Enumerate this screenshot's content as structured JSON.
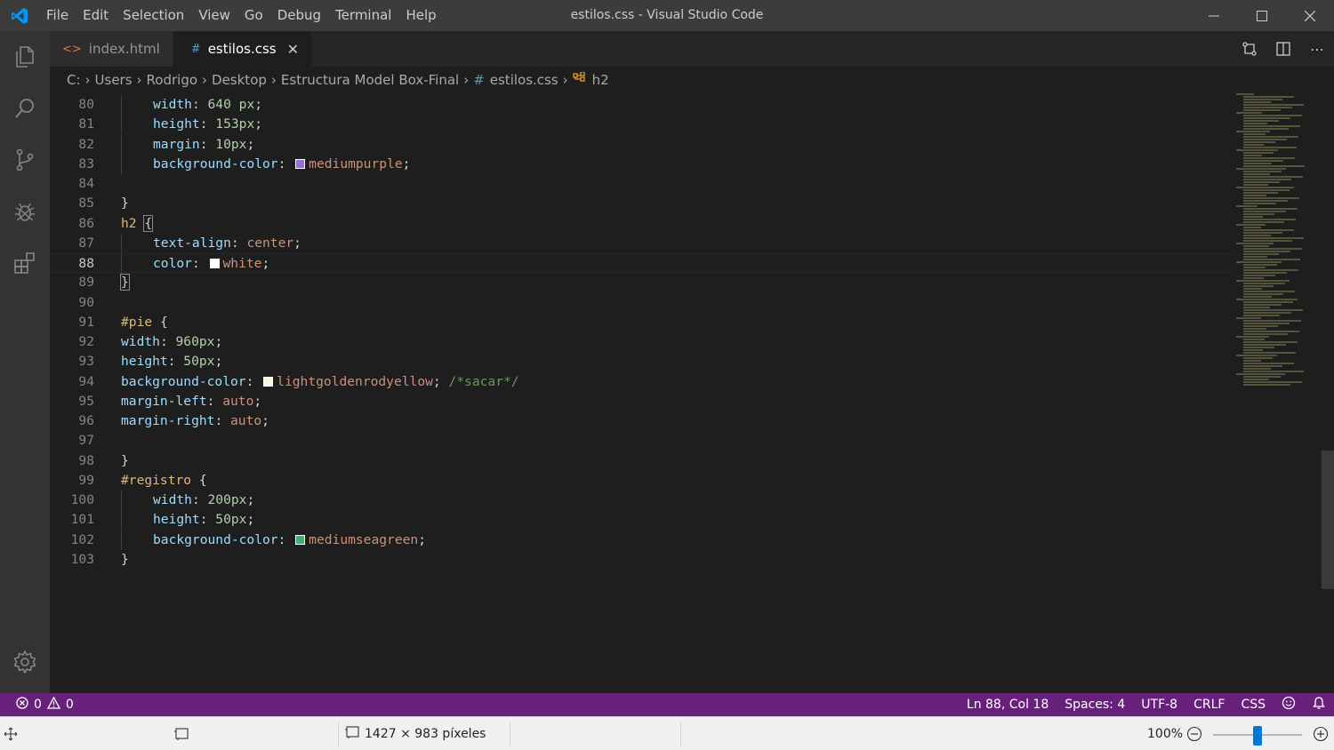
{
  "window": {
    "title": "estilos.css - Visual Studio Code",
    "menu": [
      "File",
      "Edit",
      "Selection",
      "View",
      "Go",
      "Debug",
      "Terminal",
      "Help"
    ]
  },
  "tabs": [
    {
      "label": "index.html",
      "icon": "html-file-icon",
      "active": false
    },
    {
      "label": "estilos.css",
      "icon": "css-file-icon",
      "active": true
    }
  ],
  "breadcrumb": {
    "items": [
      "C:",
      "Users",
      "Rodrigo",
      "Desktop",
      "Estructura Model Box-Final"
    ],
    "file": "estilos.css",
    "symbol": "h2"
  },
  "editor": {
    "lines": [
      {
        "n": "80",
        "indent": 1,
        "tokens": [
          [
            "prop",
            "width"
          ],
          [
            "punc",
            ": "
          ],
          [
            "num",
            "640 px"
          ],
          [
            "punc",
            ";"
          ]
        ]
      },
      {
        "n": "81",
        "indent": 1,
        "tokens": [
          [
            "prop",
            "height"
          ],
          [
            "punc",
            ": "
          ],
          [
            "num",
            "153px"
          ],
          [
            "punc",
            ";"
          ]
        ]
      },
      {
        "n": "82",
        "indent": 1,
        "tokens": [
          [
            "prop",
            "margin"
          ],
          [
            "punc",
            ": "
          ],
          [
            "num",
            "10px"
          ],
          [
            "punc",
            ";"
          ]
        ]
      },
      {
        "n": "83",
        "indent": 1,
        "tokens": [
          [
            "prop",
            "background-color"
          ],
          [
            "punc",
            ": "
          ],
          [
            "swatch",
            "#9370db"
          ],
          [
            "val",
            "mediumpurple"
          ],
          [
            "punc",
            ";"
          ]
        ]
      },
      {
        "n": "84",
        "indent": 0,
        "tokens": []
      },
      {
        "n": "85",
        "indent": 0,
        "tokens": [
          [
            "punc",
            "}"
          ]
        ]
      },
      {
        "n": "86",
        "indent": 0,
        "tokens": [
          [
            "sel",
            "h2"
          ],
          [
            "punc",
            " "
          ],
          [
            "brk",
            "{"
          ]
        ]
      },
      {
        "n": "87",
        "indent": 1,
        "tokens": [
          [
            "prop",
            "text-align"
          ],
          [
            "punc",
            ": "
          ],
          [
            "val",
            "center"
          ],
          [
            "punc",
            ";"
          ]
        ]
      },
      {
        "n": "88",
        "indent": 1,
        "tokens": [
          [
            "prop",
            "color"
          ],
          [
            "punc",
            ": "
          ],
          [
            "swatch",
            "#ffffff"
          ],
          [
            "val",
            "white"
          ],
          [
            "punc",
            ";"
          ]
        ]
      },
      {
        "n": "89",
        "indent": 0,
        "tokens": [
          [
            "brk",
            "}"
          ]
        ]
      },
      {
        "n": "90",
        "indent": 0,
        "tokens": []
      },
      {
        "n": "91",
        "indent": 0,
        "tokens": [
          [
            "sel",
            "#pie"
          ],
          [
            "punc",
            " {"
          ]
        ]
      },
      {
        "n": "92",
        "indent": 0,
        "tokens": [
          [
            "prop",
            "width"
          ],
          [
            "punc",
            ": "
          ],
          [
            "num",
            "960px"
          ],
          [
            "punc",
            ";"
          ]
        ]
      },
      {
        "n": "93",
        "indent": 0,
        "tokens": [
          [
            "prop",
            "height"
          ],
          [
            "punc",
            ": "
          ],
          [
            "num",
            "50px"
          ],
          [
            "punc",
            ";"
          ]
        ]
      },
      {
        "n": "94",
        "indent": 0,
        "tokens": [
          [
            "prop",
            "background-color"
          ],
          [
            "punc",
            ": "
          ],
          [
            "swatch",
            "#fafad2"
          ],
          [
            "val",
            "lightgoldenrodyellow"
          ],
          [
            "punc",
            "; "
          ],
          [
            "cmt",
            "/*sacar*/"
          ]
        ]
      },
      {
        "n": "95",
        "indent": 0,
        "tokens": [
          [
            "prop",
            "margin-left"
          ],
          [
            "punc",
            ": "
          ],
          [
            "val",
            "auto"
          ],
          [
            "punc",
            ";"
          ]
        ]
      },
      {
        "n": "96",
        "indent": 0,
        "tokens": [
          [
            "prop",
            "margin-right"
          ],
          [
            "punc",
            ": "
          ],
          [
            "val",
            "auto"
          ],
          [
            "punc",
            ";"
          ]
        ]
      },
      {
        "n": "97",
        "indent": 0,
        "tokens": []
      },
      {
        "n": "98",
        "indent": 0,
        "tokens": [
          [
            "punc",
            "}"
          ]
        ]
      },
      {
        "n": "99",
        "indent": 0,
        "tokens": [
          [
            "sel",
            "#registro"
          ],
          [
            "punc",
            " {"
          ]
        ]
      },
      {
        "n": "100",
        "indent": 1,
        "tokens": [
          [
            "prop",
            "width"
          ],
          [
            "punc",
            ": "
          ],
          [
            "num",
            "200px"
          ],
          [
            "punc",
            ";"
          ]
        ]
      },
      {
        "n": "101",
        "indent": 1,
        "tokens": [
          [
            "prop",
            "height"
          ],
          [
            "punc",
            ": "
          ],
          [
            "num",
            "50px"
          ],
          [
            "punc",
            ";"
          ]
        ]
      },
      {
        "n": "102",
        "indent": 1,
        "tokens": [
          [
            "prop",
            "background-color"
          ],
          [
            "punc",
            ": "
          ],
          [
            "swatch",
            "#3cb371"
          ],
          [
            "val",
            "mediumseagreen"
          ],
          [
            "punc",
            ";"
          ]
        ]
      },
      {
        "n": "103",
        "indent": 0,
        "tokens": [
          [
            "punc",
            "}"
          ]
        ]
      }
    ],
    "current_line": "88"
  },
  "status": {
    "errors": "0",
    "warnings": "0",
    "position": "Ln 88, Col 18",
    "spaces": "Spaces: 4",
    "encoding": "UTF-8",
    "eol": "CRLF",
    "language": "CSS"
  },
  "viewer": {
    "dimensions": "1427 × 983 píxeles",
    "zoom": "100%",
    "zoom_level": 0.5
  },
  "colors": {
    "statusbar": "#68217a",
    "vscode_blue": "#0098ff"
  }
}
